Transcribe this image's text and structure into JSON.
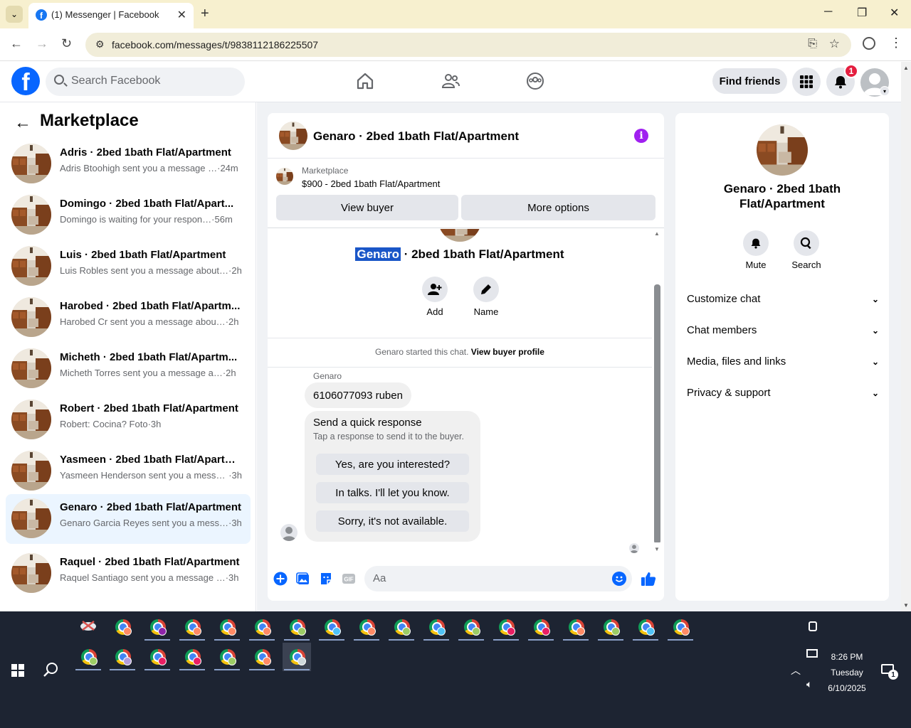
{
  "browser": {
    "tab_title": "(1) Messenger | Facebook",
    "url": "facebook.com/messages/t/9838112186225507"
  },
  "fb": {
    "search_placeholder": "Search Facebook",
    "find_friends": "Find friends",
    "notification_count": "1"
  },
  "sidebar": {
    "title": "Marketplace",
    "conversations": [
      {
        "name": "Adris · 2bed 1bath Flat/Apartment",
        "preview": "Adris Btoohigh sent you a message …",
        "time": "·24m"
      },
      {
        "name": "Domingo · 2bed 1bath Flat/Apart...",
        "preview": "Domingo is waiting for your respon…",
        "time": "·56m"
      },
      {
        "name": "Luis · 2bed 1bath Flat/Apartment",
        "preview": "Luis Robles sent you a message about…",
        "time": "·2h"
      },
      {
        "name": "Harobed · 2bed 1bath Flat/Apartm...",
        "preview": "Harobed Cr sent you a message abou…",
        "time": "·2h"
      },
      {
        "name": "Micheth · 2bed 1bath Flat/Apartm...",
        "preview": "Micheth Torres sent you a message a…",
        "time": "·2h"
      },
      {
        "name": "Robert · 2bed 1bath Flat/Apartment",
        "preview": "Robert: Cocina? Foto",
        "time": "·3h"
      },
      {
        "name": "Yasmeen · 2bed 1bath Flat/Apartm...",
        "preview": "Yasmeen Henderson sent you a messa…",
        "time": "·3h"
      },
      {
        "name": "Genaro · 2bed 1bath Flat/Apartment",
        "preview": "Genaro Garcia Reyes sent you a mess…",
        "time": "·3h"
      },
      {
        "name": "Raquel · 2bed 1bath Flat/Apartment",
        "preview": "Raquel Santiago sent you a message …",
        "time": "·3h"
      }
    ]
  },
  "chat": {
    "title": "Genaro · 2bed 1bath Flat/Apartment",
    "marketplace_label": "Marketplace",
    "item": "$900 - 2bed 1bath Flat/Apartment",
    "view_buyer": "View buyer",
    "more_options": "More options",
    "convo_title_highlight": "Genaro",
    "convo_title_rest": " · 2bed 1bath Flat/Apartment",
    "add_label": "Add",
    "name_label": "Name",
    "started_text": "Genaro started this chat.",
    "view_buyer_profile": "View buyer profile",
    "sender": "Genaro",
    "message": "6106077093 ruben",
    "quick_response_title": "Send a quick response",
    "quick_response_sub": "Tap a response to send it to the buyer.",
    "quick_responses": [
      "Yes, are you interested?",
      "In talks. I'll let you know.",
      "Sorry, it's not available."
    ],
    "input_placeholder": "Aa"
  },
  "info_panel": {
    "title": "Genaro · 2bed 1bath Flat/Apartment",
    "mute": "Mute",
    "search": "Search",
    "sections": [
      "Customize chat",
      "Chat members",
      "Media, files and links",
      "Privacy & support"
    ]
  },
  "taskbar": {
    "time": "8:26 PM",
    "day": "Tuesday",
    "date": "6/10/2025",
    "notification_count": "1"
  }
}
